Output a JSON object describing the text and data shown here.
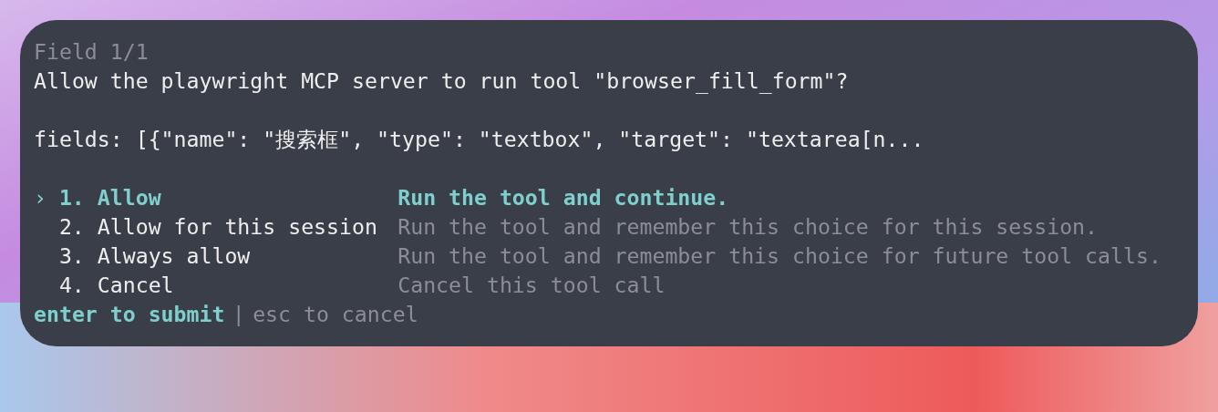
{
  "header": "Field 1/1",
  "question": "Allow the playwright MCP server to run tool \"browser_fill_form\"?",
  "arguments": "fields: [{\"name\": \"搜索框\", \"type\": \"textbox\", \"target\": \"textarea[n...",
  "pointer": "›",
  "options": [
    {
      "label": "1. Allow",
      "description": "Run the tool and continue.",
      "selected": true
    },
    {
      "label": "2. Allow for this session",
      "description": "Run the tool and remember this choice for this session.",
      "selected": false
    },
    {
      "label": "3. Always allow",
      "description": "Run the tool and remember this choice for future tool calls.",
      "selected": false
    },
    {
      "label": "4. Cancel",
      "description": "Cancel this tool call",
      "selected": false
    }
  ],
  "footer": {
    "submit_hint": "enter to submit",
    "separator": "|",
    "cancel_hint": "esc to cancel"
  }
}
